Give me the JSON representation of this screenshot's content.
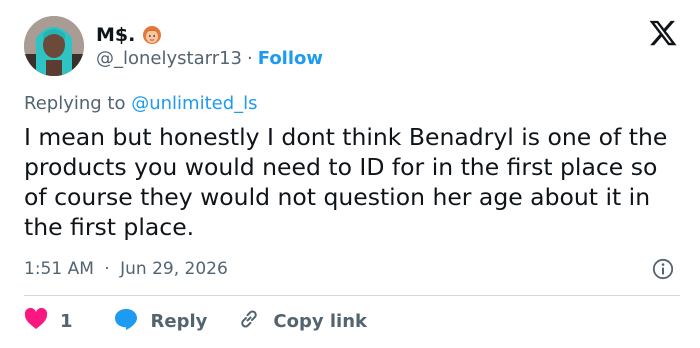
{
  "colors": {
    "text_primary": "#0f1419",
    "text_secondary": "#536471",
    "accent": "#1d9bf0",
    "like": "#f91880",
    "divider": "#cfd9de"
  },
  "user": {
    "display_name": "M$.",
    "handle": "@_lonelystarr13",
    "separator": "·",
    "follow_label": "Follow",
    "name_emoji_icon": "woman-redhair-emoji-icon"
  },
  "reply": {
    "prefix": "Replying to",
    "mention": "@unlimited_ls"
  },
  "tweet": {
    "text": "I mean but honestly I dont think Benadryl is one of the products you would need to ID for in the first place so of course they would not question her age about it in the first place.",
    "time": "1:51 AM",
    "separator": "·",
    "date": "Jun 29, 2026"
  },
  "actions": {
    "like_count": "1",
    "reply_label": "Reply",
    "copy_link_label": "Copy link"
  },
  "icons": [
    "x-logo-icon",
    "info-icon",
    "heart-icon",
    "reply-bubble-icon",
    "link-icon"
  ]
}
